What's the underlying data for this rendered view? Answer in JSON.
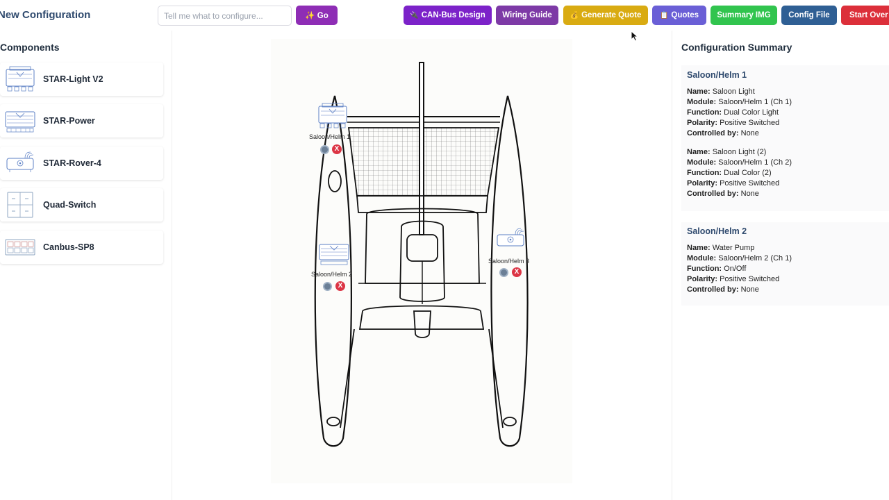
{
  "header": {
    "title": "New Configuration",
    "ai_prompt": {
      "placeholder": "Tell me what to configure...",
      "value": ""
    },
    "go_button": "✨ Go",
    "buttons": {
      "can_bus": "CAN-Bus Design",
      "wiring": "Wiring Guide",
      "quote": "Generate Quote",
      "quotes": "Quotes",
      "summary_img": "Summary IMG",
      "config_file": "Config File",
      "start_over": "Start Over"
    },
    "button_colors": {
      "go": "#8e2db5",
      "can_bus": "#7c22c9",
      "wiring": "#7d3aa6",
      "quote": "#d9ab12",
      "quotes": "#6a5fd6",
      "summary_img": "#31c44e",
      "config_file": "#2f5f94",
      "start_over": "#dc2f3a"
    }
  },
  "components": {
    "title": "Components",
    "items": [
      {
        "label": "STAR-Light V2",
        "icon": "star-light-module-icon"
      },
      {
        "label": "STAR-Power",
        "icon": "star-power-module-icon"
      },
      {
        "label": "STAR-Rover-4",
        "icon": "star-rover-module-icon"
      },
      {
        "label": "Quad-Switch",
        "icon": "quad-switch-icon"
      },
      {
        "label": "Canbus-SP8",
        "icon": "canbus-sp8-icon"
      }
    ]
  },
  "canvas": {
    "placed_modules": [
      {
        "label": "Saloon/Helm 1",
        "icon": "star-light-module-icon"
      },
      {
        "label": "Saloon/Helm 2",
        "icon": "star-power-module-icon"
      },
      {
        "label": "Saloon/Helm 3",
        "icon": "star-rover-module-icon"
      }
    ],
    "remove_glyph": "X"
  },
  "summary": {
    "title": "Configuration Summary",
    "labels": {
      "name": "Name:",
      "module": "Module:",
      "function": "Function:",
      "polarity": "Polarity:",
      "controlled_by": "Controlled by:"
    },
    "modules": [
      {
        "heading": "Saloon/Helm 1",
        "entries": [
          {
            "name": "Saloon Light",
            "module": "Saloon/Helm 1 (Ch 1)",
            "function": "Dual Color Light",
            "polarity": "Positive Switched",
            "controlled_by": "None"
          },
          {
            "name": "Saloon Light (2)",
            "module": "Saloon/Helm 1 (Ch 2)",
            "function": "Dual Color (2)",
            "polarity": "Positive Switched",
            "controlled_by": "None"
          }
        ]
      },
      {
        "heading": "Saloon/Helm 2",
        "entries": [
          {
            "name": "Water Pump",
            "module": "Saloon/Helm 2 (Ch 1)",
            "function": "On/Off",
            "polarity": "Positive Switched",
            "controlled_by": "None"
          }
        ]
      }
    ]
  }
}
